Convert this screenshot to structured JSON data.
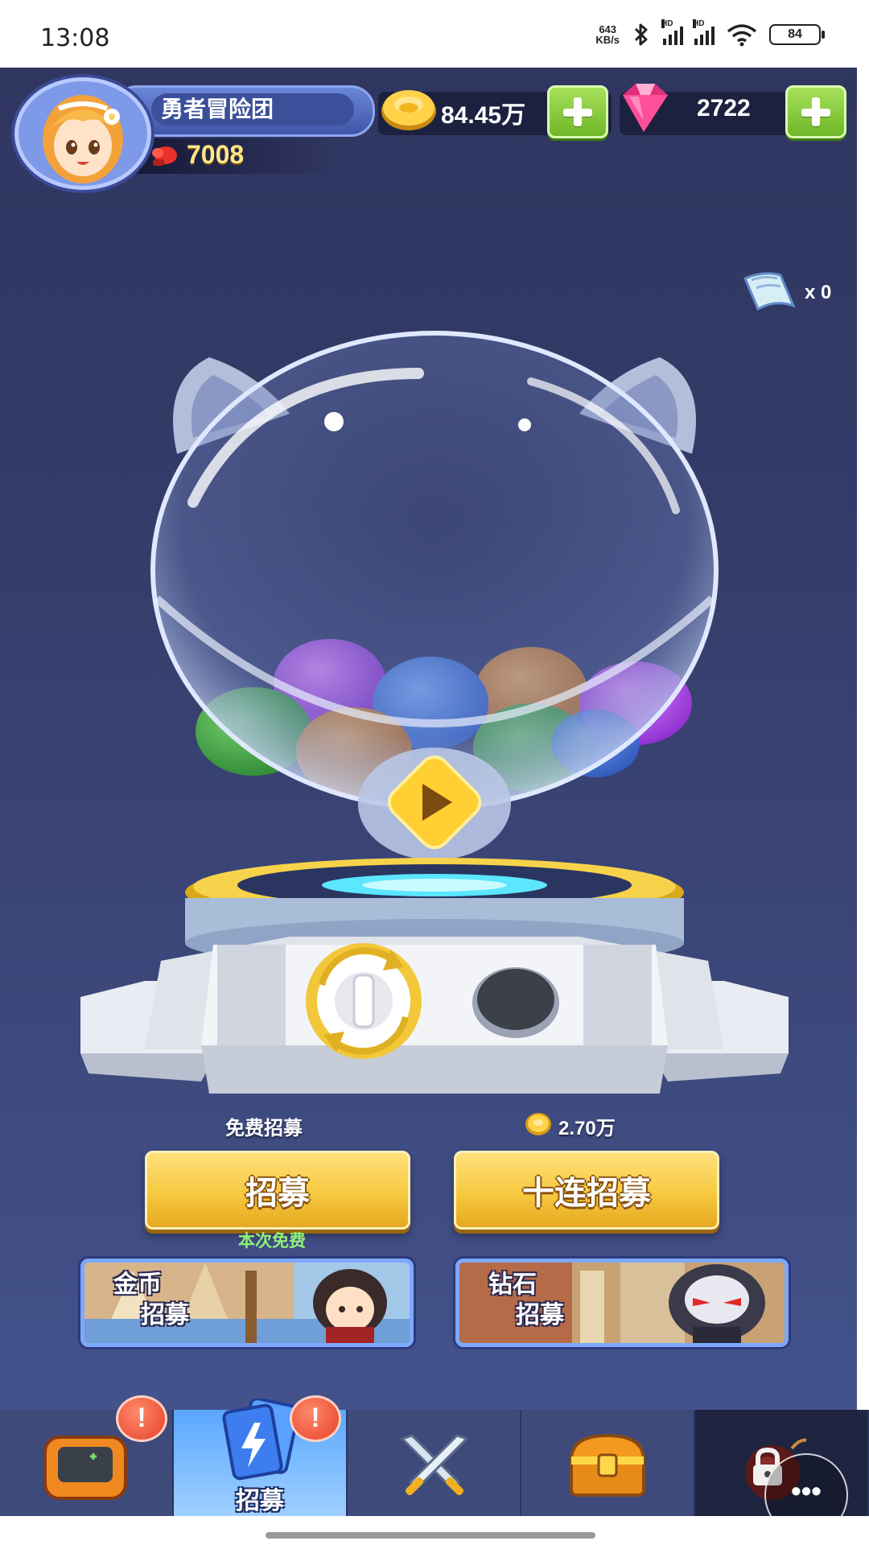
{
  "status_bar": {
    "time": "13:08",
    "net_speed_value": "643",
    "net_speed_unit": "KB/s",
    "signal1_label": "HD",
    "signal2_label": "HD",
    "battery": "84"
  },
  "player": {
    "name": "勇者冒险团",
    "power": "7008"
  },
  "currency": {
    "gold": "84.45万",
    "gems": "2722"
  },
  "ticket_count": "x 0",
  "recruit": {
    "single_cost_label": "免费招募",
    "single_button": "招募",
    "single_note": "本次免费",
    "ten_cost": "2.70万",
    "ten_button": "十连招募"
  },
  "banners": [
    {
      "line1": "金币",
      "line2": "招募"
    },
    {
      "line1": "钻石",
      "line2": "招募"
    }
  ],
  "bottom_nav": {
    "active_label": "招募",
    "alert_mark": "!"
  },
  "more_label": "•••",
  "colors": {
    "background": "#3a4575",
    "gold_button": "#f6c940",
    "plus_button": "#8ad042",
    "active_tab": "#5aa7ff",
    "free_note": "#8ff07a"
  }
}
